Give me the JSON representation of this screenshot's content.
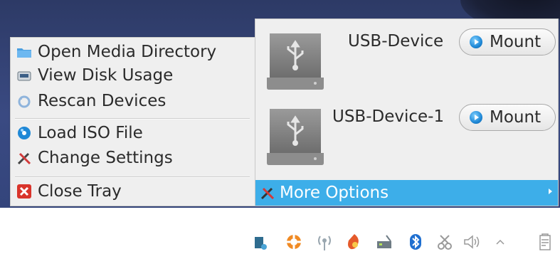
{
  "left_menu": {
    "items": [
      {
        "label": "Open Media Directory",
        "icon": "folder-icon"
      },
      {
        "label": "View Disk Usage",
        "icon": "disk-usage-icon"
      },
      {
        "label": "Rescan Devices",
        "icon": "rescan-icon"
      },
      {
        "label": "Load ISO File",
        "icon": "disc-icon"
      },
      {
        "label": "Change Settings",
        "icon": "tools-icon"
      },
      {
        "label": "Close Tray",
        "icon": "close-icon"
      }
    ]
  },
  "devices": [
    {
      "name": "USB-Device",
      "button": "Mount",
      "icon": "usb-drive-icon"
    },
    {
      "name": "USB-Device-1",
      "button": "Mount",
      "icon": "usb-drive-icon"
    }
  ],
  "more_options": {
    "label": "More Options",
    "icon": "tools-icon",
    "submenu": "chevron-right-icon"
  },
  "tray": {
    "icons": [
      "volume-app-icon",
      "lifebuoy-icon",
      "wireless-icon",
      "firewall-icon",
      "network-icon",
      "bluetooth-icon",
      "tools-icon",
      "volume-icon",
      "expand-arrow-icon",
      "clipboard-icon"
    ]
  },
  "colors": {
    "accent": "#3daee9",
    "menu_bg": "#efefef",
    "desktop": "#34457c"
  }
}
